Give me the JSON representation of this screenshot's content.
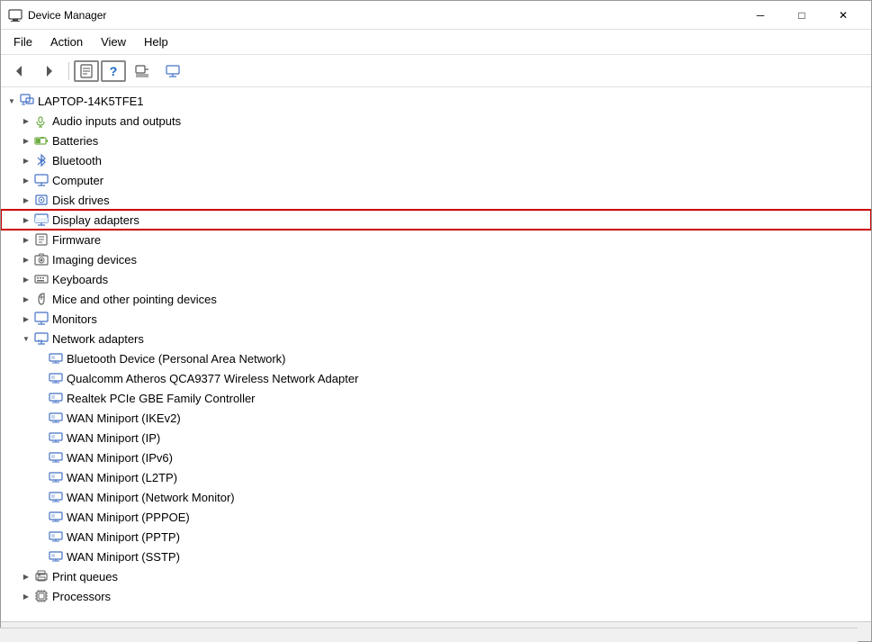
{
  "window": {
    "title": "Device Manager",
    "icon": "🖥️"
  },
  "title_bar": {
    "title": "Device Manager",
    "minimize_label": "─",
    "maximize_label": "□",
    "close_label": "✕"
  },
  "menu_bar": {
    "items": [
      {
        "id": "file",
        "label": "File"
      },
      {
        "id": "action",
        "label": "Action"
      },
      {
        "id": "view",
        "label": "View"
      },
      {
        "id": "help",
        "label": "Help"
      }
    ]
  },
  "toolbar": {
    "buttons": [
      {
        "id": "back",
        "icon": "◀",
        "title": "Back"
      },
      {
        "id": "forward",
        "icon": "▶",
        "title": "Forward"
      },
      {
        "id": "properties",
        "icon": "🖹",
        "title": "Properties"
      },
      {
        "id": "help",
        "icon": "?",
        "title": "Help"
      },
      {
        "id": "update",
        "icon": "⊞",
        "title": "Update"
      },
      {
        "id": "computer",
        "icon": "🖥",
        "title": "Computer"
      }
    ]
  },
  "tree": {
    "items": [
      {
        "id": "root",
        "label": "LAPTOP-14K5TFE1",
        "indent": 0,
        "expanded": true,
        "icon": "computer",
        "expand_state": "expanded"
      },
      {
        "id": "audio",
        "label": "Audio inputs and outputs",
        "indent": 1,
        "expanded": false,
        "icon": "audio",
        "expand_state": "collapsed"
      },
      {
        "id": "batteries",
        "label": "Batteries",
        "indent": 1,
        "expanded": false,
        "icon": "battery",
        "expand_state": "collapsed"
      },
      {
        "id": "bluetooth",
        "label": "Bluetooth",
        "indent": 1,
        "expanded": false,
        "icon": "bluetooth",
        "expand_state": "collapsed"
      },
      {
        "id": "computer",
        "label": "Computer",
        "indent": 1,
        "expanded": false,
        "icon": "computer",
        "expand_state": "collapsed"
      },
      {
        "id": "disk",
        "label": "Disk drives",
        "indent": 1,
        "expanded": false,
        "icon": "disk",
        "expand_state": "collapsed"
      },
      {
        "id": "display",
        "label": "Display adapters",
        "indent": 1,
        "expanded": false,
        "icon": "display",
        "expand_state": "collapsed",
        "highlighted": true
      },
      {
        "id": "firmware",
        "label": "Firmware",
        "indent": 1,
        "expanded": false,
        "icon": "generic",
        "expand_state": "collapsed"
      },
      {
        "id": "imaging",
        "label": "Imaging devices",
        "indent": 1,
        "expanded": false,
        "icon": "camera",
        "expand_state": "collapsed"
      },
      {
        "id": "keyboards",
        "label": "Keyboards",
        "indent": 1,
        "expanded": false,
        "icon": "keyboard",
        "expand_state": "collapsed"
      },
      {
        "id": "mice",
        "label": "Mice and other pointing devices",
        "indent": 1,
        "expanded": false,
        "icon": "mouse",
        "expand_state": "collapsed"
      },
      {
        "id": "monitors",
        "label": "Monitors",
        "indent": 1,
        "expanded": false,
        "icon": "monitor",
        "expand_state": "collapsed"
      },
      {
        "id": "network",
        "label": "Network adapters",
        "indent": 1,
        "expanded": true,
        "icon": "network",
        "expand_state": "expanded"
      },
      {
        "id": "bt-device",
        "label": "Bluetooth Device (Personal Area Network)",
        "indent": 2,
        "icon": "net-card",
        "expand_state": "none"
      },
      {
        "id": "qualcomm",
        "label": "Qualcomm Atheros QCA9377 Wireless Network Adapter",
        "indent": 2,
        "icon": "net-card",
        "expand_state": "none"
      },
      {
        "id": "realtek",
        "label": "Realtek PCIe GBE Family Controller",
        "indent": 2,
        "icon": "net-card",
        "expand_state": "none"
      },
      {
        "id": "wan-ikev2",
        "label": "WAN Miniport (IKEv2)",
        "indent": 2,
        "icon": "net-card",
        "expand_state": "none"
      },
      {
        "id": "wan-ip",
        "label": "WAN Miniport (IP)",
        "indent": 2,
        "icon": "net-card",
        "expand_state": "none"
      },
      {
        "id": "wan-ipv6",
        "label": "WAN Miniport (IPv6)",
        "indent": 2,
        "icon": "net-card",
        "expand_state": "none"
      },
      {
        "id": "wan-l2tp",
        "label": "WAN Miniport (L2TP)",
        "indent": 2,
        "icon": "net-card",
        "expand_state": "none"
      },
      {
        "id": "wan-netmon",
        "label": "WAN Miniport (Network Monitor)",
        "indent": 2,
        "icon": "net-card",
        "expand_state": "none"
      },
      {
        "id": "wan-pppoe",
        "label": "WAN Miniport (PPPOE)",
        "indent": 2,
        "icon": "net-card",
        "expand_state": "none"
      },
      {
        "id": "wan-pptp",
        "label": "WAN Miniport (PPTP)",
        "indent": 2,
        "icon": "net-card",
        "expand_state": "none"
      },
      {
        "id": "wan-sstp",
        "label": "WAN Miniport (SSTP)",
        "indent": 2,
        "icon": "net-card",
        "expand_state": "none"
      },
      {
        "id": "print",
        "label": "Print queues",
        "indent": 1,
        "expanded": false,
        "icon": "printer",
        "expand_state": "collapsed"
      },
      {
        "id": "processors",
        "label": "Processors",
        "indent": 1,
        "expanded": false,
        "icon": "cpu",
        "expand_state": "collapsed"
      }
    ]
  },
  "icons": {
    "computer": "🖥",
    "audio": "🔊",
    "battery": "🔋",
    "bluetooth": "🔵",
    "disk": "💾",
    "display": "🖥",
    "generic": "⚙",
    "camera": "📷",
    "keyboard": "⌨",
    "mouse": "🖱",
    "monitor": "🖥",
    "network": "🖥",
    "net-card": "🖥",
    "printer": "🖨",
    "cpu": "💻"
  }
}
